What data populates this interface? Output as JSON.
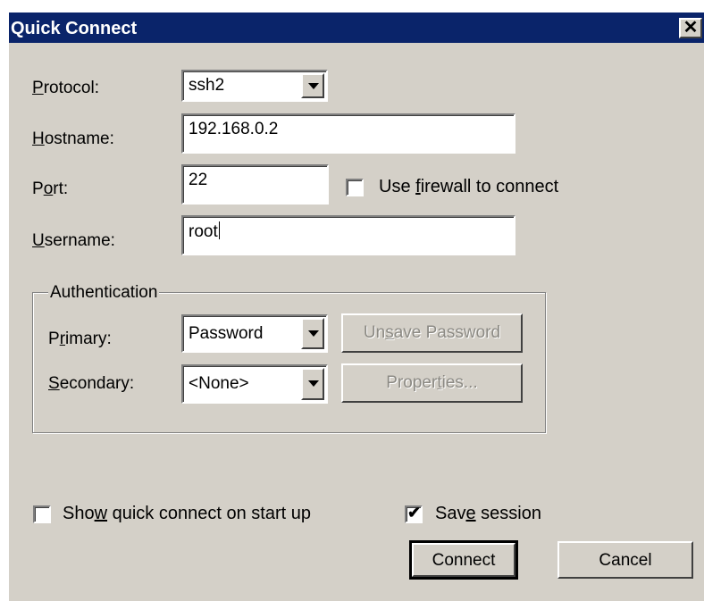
{
  "window": {
    "title": "Quick Connect",
    "close_glyph": "✕"
  },
  "form": {
    "protocol": {
      "label_pre": "",
      "label_key": "P",
      "label_post": "rotocol:",
      "value": "ssh2"
    },
    "hostname": {
      "label_pre": "",
      "label_key": "H",
      "label_post": "ostname:",
      "value": "192.168.0.2"
    },
    "port": {
      "label_pre": "P",
      "label_key": "o",
      "label_post": "rt:",
      "value": "22"
    },
    "firewall": {
      "label_pre": "Use ",
      "label_key": "f",
      "label_post": "irewall to connect",
      "checked": false
    },
    "username": {
      "label_pre": "",
      "label_key": "U",
      "label_post": "sername:",
      "value": "root"
    }
  },
  "authentication": {
    "group_title": "Authentication",
    "primary": {
      "label_pre": "P",
      "label_key": "r",
      "label_post": "imary:",
      "value": "Password"
    },
    "secondary": {
      "label_pre": "",
      "label_key": "S",
      "label_post": "econdary:",
      "value": "<None>"
    },
    "unsave_password": {
      "label_pre": "Un",
      "label_key": "s",
      "label_post": "ave Password",
      "enabled": false
    },
    "properties": {
      "label_pre": "Proper",
      "label_key": "t",
      "label_post": "ies...",
      "enabled": false
    }
  },
  "options": {
    "show_on_startup": {
      "label_pre": "Sho",
      "label_key": "w",
      "label_post": " quick connect on start up",
      "checked": false
    },
    "save_session": {
      "label_pre": "Sav",
      "label_key": "e",
      "label_post": " session",
      "checked": true
    }
  },
  "buttons": {
    "connect": "Connect",
    "cancel": "Cancel"
  },
  "colors": {
    "titlebar": "#0a246a",
    "dialog_bg": "#d4d0c8",
    "disabled_text": "#8c8a84"
  },
  "icons": {
    "dropdown": "chevron-down-icon",
    "checkmark": "checkmark-icon",
    "close": "close-icon"
  }
}
